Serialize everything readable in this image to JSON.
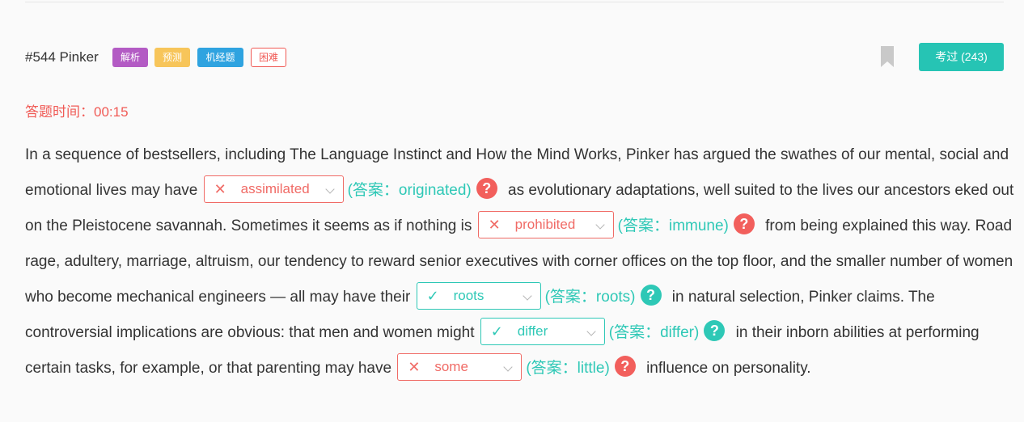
{
  "header": {
    "question_id": "#544 Pinker",
    "tags": [
      "解析",
      "预测",
      "机经题",
      "困难"
    ],
    "exam_button": "考过 (243)"
  },
  "timer": "答题时间：00:15",
  "passage": {
    "t0": "In a sequence of bestsellers, including The Language Instinct and How the Mind Works, Pinker has argued the swathes of our mental, social and emotional lives may have",
    "b1": {
      "mark": "✕",
      "value": "assimilated",
      "answer": "(答案：originated)"
    },
    "t1": "as evolutionary adaptations, well suited to the lives our ancestors eked out on the Pleistocene savannah. Sometimes it seems as if nothing is",
    "b2": {
      "mark": "✕",
      "value": "prohibited",
      "answer": "(答案：immune)"
    },
    "t2": "from being explained this way. Road rage, adultery, marriage, altruism, our tendency to reward senior executives with corner offices on the top floor, and the smaller number of women who become mechanical engineers — all may have their",
    "b3": {
      "mark": "✓",
      "value": "roots",
      "answer": "(答案：roots)"
    },
    "t3": "in natural selection, Pinker claims. The controversial implications are obvious: that men and women might",
    "b4": {
      "mark": "✓",
      "value": "differ",
      "answer": "(答案：differ)"
    },
    "t4": "in their inborn abilities at performing certain tasks, for example, or that parenting may have",
    "b5": {
      "mark": "✕",
      "value": "some",
      "answer": "(答案：little)"
    },
    "t5": "influence on personality."
  },
  "help_glyph": "?",
  "colors": {
    "accent_teal": "#2ec8b6",
    "error_red": "#f06b66",
    "tag_purple": "#b35bc4",
    "tag_yellow": "#f7c55a",
    "tag_blue": "#2fa3e0"
  }
}
